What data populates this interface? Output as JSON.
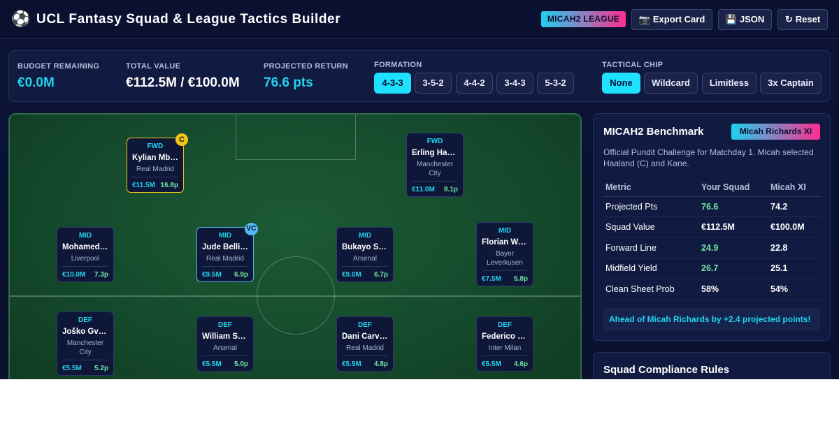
{
  "header": {
    "logo_icon": "soccer-ball-icon",
    "title": "UCL Fantasy Squad & League Tactics Builder",
    "league_badge": "MICAH2 LEAGUE",
    "export_label": "Export Card",
    "export_icon": "camera-icon",
    "json_label": "JSON",
    "json_icon": "floppy-disk-icon",
    "reset_label": "Reset",
    "reset_icon": "refresh-icon"
  },
  "stats": {
    "budget_label": "BUDGET REMAINING",
    "budget_value": "€0.0M",
    "total_label": "TOTAL VALUE",
    "total_value": "€112.5M / €100.0M",
    "projected_label": "PROJECTED RETURN",
    "projected_value": "76.6 pts",
    "formation_label": "FORMATION",
    "formations": [
      "4-3-3",
      "3-5-2",
      "4-4-2",
      "3-4-3",
      "5-3-2"
    ],
    "formation_selected": "4-3-3",
    "chip_label": "TACTICAL CHIP",
    "chips": [
      "None",
      "Wildcard",
      "Limitless",
      "3x Captain"
    ],
    "chip_selected": "None"
  },
  "pitch": {
    "players": [
      {
        "pos": "FWD",
        "name": "Kylian Mbappé",
        "club": "Real Madrid",
        "price": "€11.5M",
        "pts": "16.8p",
        "badge": "C"
      },
      {
        "pos": "FWD",
        "name": "Erling Haaland",
        "club": "Manchester City",
        "price": "€11.0M",
        "pts": "8.1p",
        "badge": ""
      },
      {
        "pos": "MID",
        "name": "Mohamed Salah",
        "club": "Liverpool",
        "price": "€10.0M",
        "pts": "7.3p",
        "badge": ""
      },
      {
        "pos": "MID",
        "name": "Jude Bellingham",
        "club": "Real Madrid",
        "price": "€9.5M",
        "pts": "6.9p",
        "badge": "VC"
      },
      {
        "pos": "MID",
        "name": "Bukayo Saka",
        "club": "Arsenal",
        "price": "€9.0M",
        "pts": "6.7p",
        "badge": ""
      },
      {
        "pos": "MID",
        "name": "Florian Wirtz",
        "club": "Bayer Leverkusen",
        "price": "€7.5M",
        "pts": "5.8p",
        "badge": ""
      },
      {
        "pos": "DEF",
        "name": "Joško Gvardiol",
        "club": "Manchester City",
        "price": "€5.5M",
        "pts": "5.2p",
        "badge": ""
      },
      {
        "pos": "DEF",
        "name": "William Saliba",
        "club": "Arsenal",
        "price": "€5.5M",
        "pts": "5.0p",
        "badge": ""
      },
      {
        "pos": "DEF",
        "name": "Dani Carvajal",
        "club": "Real Madrid",
        "price": "€5.5M",
        "pts": "4.8p",
        "badge": ""
      },
      {
        "pos": "DEF",
        "name": "Federico Dimarco",
        "club": "Inter Milan",
        "price": "€5.5M",
        "pts": "4.6p",
        "badge": ""
      }
    ]
  },
  "benchmark": {
    "title": "MICAH2 Benchmark",
    "tag": "Micah Richards XI",
    "description": "Official Pundit Challenge for Matchday 1. Micah selected Haaland (C) and Kane.",
    "headers": [
      "Metric",
      "Your Squad",
      "Micah XI"
    ],
    "rows": [
      {
        "metric": "Projected Pts",
        "you": "76.6",
        "micah": "74.2",
        "highlight": true
      },
      {
        "metric": "Squad Value",
        "you": "€112.5M",
        "micah": "€100.0M",
        "highlight": false
      },
      {
        "metric": "Forward Line",
        "you": "24.9",
        "micah": "22.8",
        "highlight": true
      },
      {
        "metric": "Midfield Yield",
        "you": "26.7",
        "micah": "25.1",
        "highlight": true
      },
      {
        "metric": "Clean Sheet Prob",
        "you": "58%",
        "micah": "54%",
        "highlight": false
      }
    ],
    "note": "Ahead of Micah Richards by +2.4 projected points!"
  },
  "compliance": {
    "title": "Squad Compliance Rules"
  },
  "colors": {
    "accent": "#22d3ee",
    "positive": "#6ee7a0",
    "captain": "#f5c518",
    "vice_captain": "#56b8f0",
    "background": "#0b1235"
  }
}
